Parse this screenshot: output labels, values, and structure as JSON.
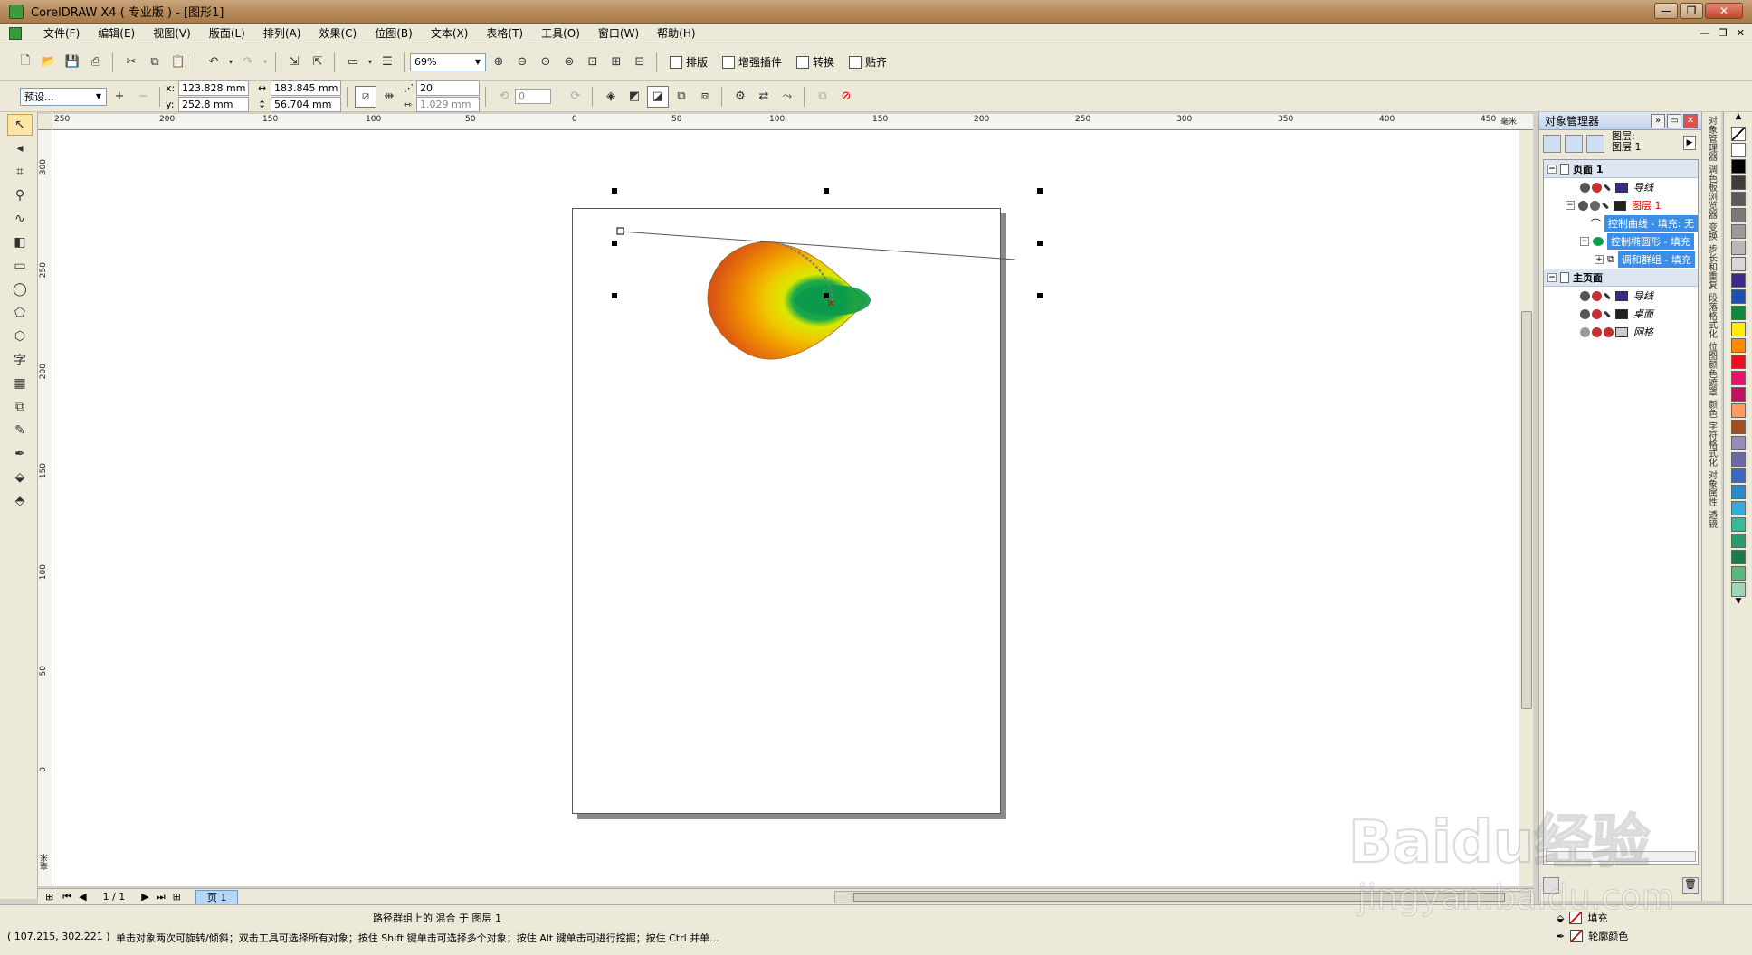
{
  "window": {
    "title": "CorelDRAW X4 ( 专业版 ) - [图形1]"
  },
  "menu": {
    "items": [
      "文件(F)",
      "编辑(E)",
      "视图(V)",
      "版面(L)",
      "排列(A)",
      "效果(C)",
      "位图(B)",
      "文本(X)",
      "表格(T)",
      "工具(O)",
      "窗口(W)",
      "帮助(H)"
    ]
  },
  "toolbar": {
    "zoom": "69%",
    "plugins": [
      "排版",
      "增强插件",
      "转换",
      "贴齐"
    ]
  },
  "propertybar": {
    "preset": "预设...",
    "x_label": "x:",
    "y_label": "y:",
    "x": "123.828 mm",
    "y": "252.8 mm",
    "w": "183.845 mm",
    "h": "56.704 mm",
    "steps": "20",
    "spacing": "1.029 mm",
    "rotation": "0"
  },
  "rulers": {
    "h_ticks": [
      "250",
      "200",
      "150",
      "100",
      "50",
      "0",
      "50",
      "100",
      "150",
      "200",
      "250",
      "300",
      "350",
      "400",
      "450"
    ],
    "h_unit": "毫米",
    "v_ticks": [
      "300",
      "250",
      "200",
      "150",
      "100",
      "50",
      "0"
    ],
    "v_unit": "毫米"
  },
  "pagebar": {
    "counter": "1 / 1",
    "tab": "页 1"
  },
  "status": {
    "center": "路径群组上的 混合 于 图层 1",
    "coords": "( 107.215, 302.221 )",
    "hint": "单击对象两次可旋转/倾斜；双击工具可选择所有对象；按住 Shift 键单击可选择多个对象；按住 Alt 键单击可进行挖掘；按住 Ctrl 并单...",
    "fill_label": "填充",
    "outline_label": "轮廓颜色"
  },
  "docker": {
    "title": "对象管理器",
    "layer_label_1": "图层:",
    "layer_label_2": "图层 1",
    "tree": {
      "page1": "页面 1",
      "guides": "导线",
      "layer1": "图层 1",
      "obj_curve": "控制曲线 - 填充: 无",
      "obj_ellipse": "控制椭圆形 - 填充",
      "obj_blend": "调和群组 - 填充",
      "master": "主页面",
      "m_guides": "导线",
      "m_desktop": "桌面",
      "m_grid": "网格"
    }
  },
  "vtabs": [
    "对象管理器",
    "调色板浏览器",
    "变换",
    "步长和重复",
    "段落格式化",
    "位图颜色遮罩",
    "颜色",
    "字符格式化",
    "对象属性",
    "透镜"
  ],
  "palette": {
    "colors": [
      "#ffffff",
      "#000000",
      "#3c3c3c",
      "#5a5a5a",
      "#7a7a7a",
      "#9a9a9a",
      "#b8b8b8",
      "#d8d8d8",
      "#3a2a8a",
      "#1c4fb0",
      "#0a8a3a",
      "#ffee00",
      "#ff8a00",
      "#e81020",
      "#e8106a",
      "#c01060",
      "#ff9a60",
      "#a05020",
      "#9a8ab8",
      "#6a6aa8",
      "#3a6ab8",
      "#2a8ac8",
      "#3aa8d8",
      "#3ab89a",
      "#2a9a6a",
      "#1a7a4a",
      "#5ab87a",
      "#9ad8b8"
    ]
  },
  "watermark": {
    "main": "Baidu经验",
    "sub": "jingyan.baidu.com"
  }
}
